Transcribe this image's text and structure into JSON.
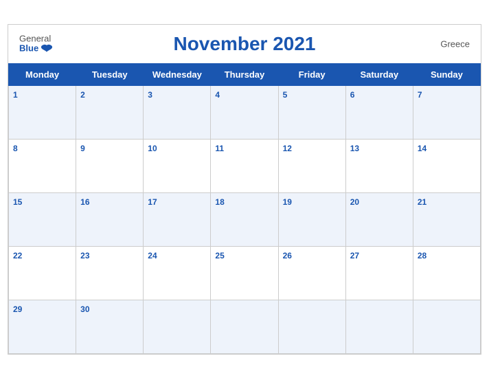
{
  "header": {
    "logo_general": "General",
    "logo_blue": "Blue",
    "title": "November 2021",
    "country": "Greece"
  },
  "weekdays": [
    "Monday",
    "Tuesday",
    "Wednesday",
    "Thursday",
    "Friday",
    "Saturday",
    "Sunday"
  ],
  "weeks": [
    [
      {
        "day": "1"
      },
      {
        "day": "2"
      },
      {
        "day": "3"
      },
      {
        "day": "4"
      },
      {
        "day": "5"
      },
      {
        "day": "6"
      },
      {
        "day": "7"
      }
    ],
    [
      {
        "day": "8"
      },
      {
        "day": "9"
      },
      {
        "day": "10"
      },
      {
        "day": "11"
      },
      {
        "day": "12"
      },
      {
        "day": "13"
      },
      {
        "day": "14"
      }
    ],
    [
      {
        "day": "15"
      },
      {
        "day": "16"
      },
      {
        "day": "17"
      },
      {
        "day": "18"
      },
      {
        "day": "19"
      },
      {
        "day": "20"
      },
      {
        "day": "21"
      }
    ],
    [
      {
        "day": "22"
      },
      {
        "day": "23"
      },
      {
        "day": "24"
      },
      {
        "day": "25"
      },
      {
        "day": "26"
      },
      {
        "day": "27"
      },
      {
        "day": "28"
      }
    ],
    [
      {
        "day": "29"
      },
      {
        "day": "30"
      },
      {
        "day": ""
      },
      {
        "day": ""
      },
      {
        "day": ""
      },
      {
        "day": ""
      },
      {
        "day": ""
      }
    ]
  ]
}
